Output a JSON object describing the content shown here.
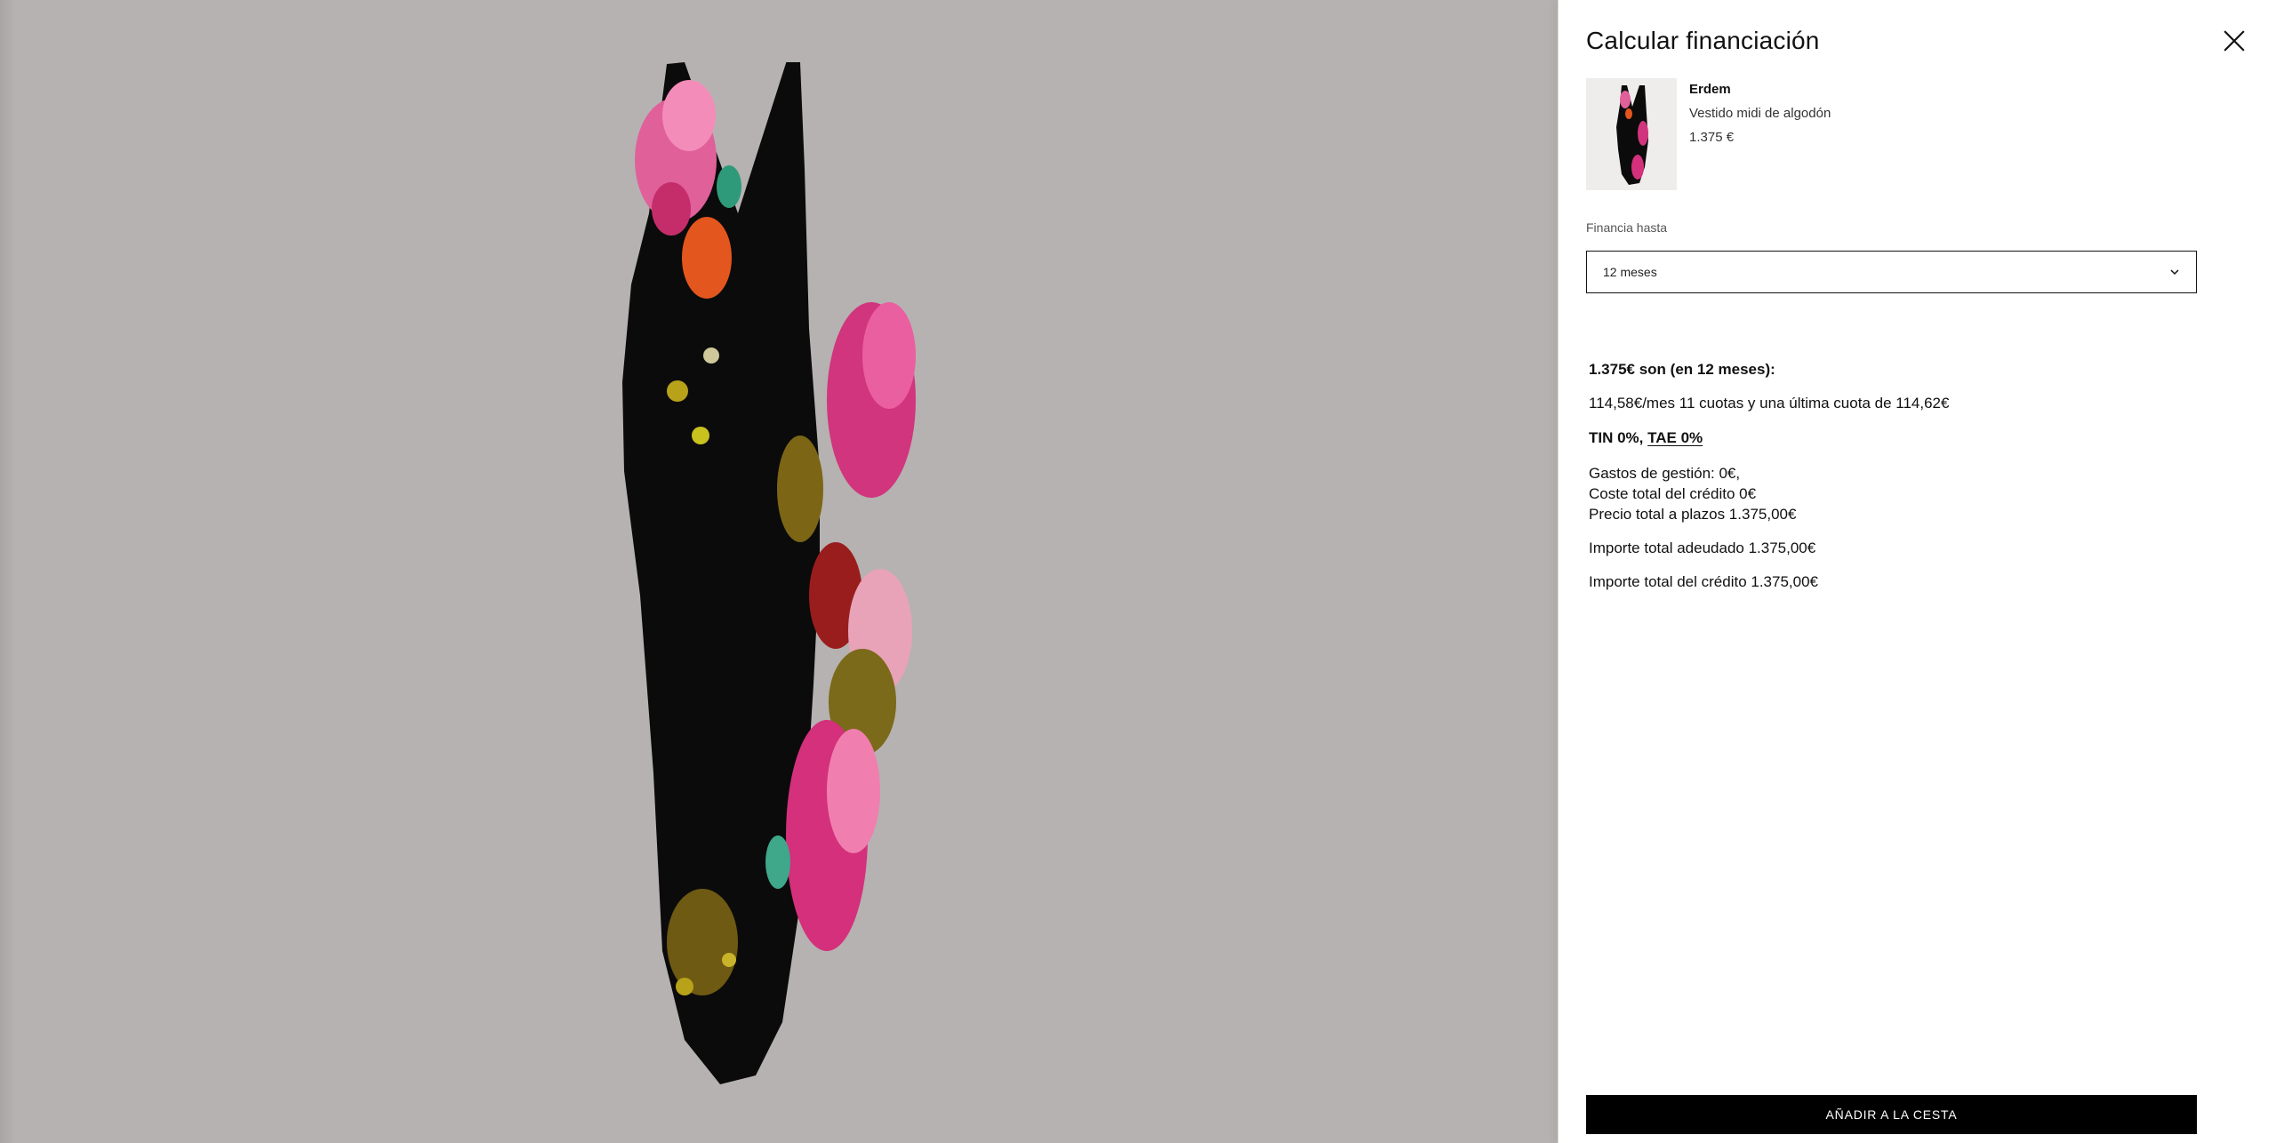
{
  "drawer": {
    "title": "Calcular financiación",
    "close_icon": "close-icon"
  },
  "product": {
    "brand": "Erdem",
    "name": "Vestido midi de algodón",
    "price": "1.375 €",
    "thumbnail_icon": "dress-thumbnail"
  },
  "financing": {
    "label": "Financia hasta",
    "selected": "12 meses",
    "chevron_icon": "chevron-down-icon"
  },
  "summary": {
    "heading": "1.375€ son (en 12 meses):",
    "monthly": "114,58€/mes 11 cuotas y una última cuota de 114,62€",
    "tin": "TIN 0%,",
    "tae": "TAE 0%",
    "management_fees": "Gastos de gestión: 0€,",
    "total_credit_cost": "Coste total del crédito 0€",
    "total_installment_price": "Precio total a plazos 1.375,00€",
    "total_owed": "Importe total adeudado 1.375,00€",
    "total_credit_amount": "Importe total del crédito 1.375,00€"
  },
  "actions": {
    "add_to_cart": "AÑADIR A LA CESTA"
  },
  "colors": {
    "backdrop": "#b6b2b1",
    "button": "#000000",
    "drawer": "#ffffff"
  }
}
